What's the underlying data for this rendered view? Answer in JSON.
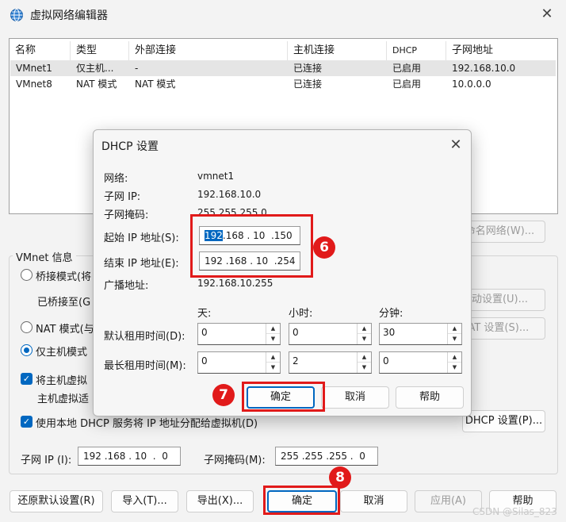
{
  "window": {
    "title": "虚拟网络编辑器",
    "close_glyph": "✕"
  },
  "netlist": {
    "headers": [
      "名称",
      "类型",
      "外部连接",
      "主机连接",
      "DHCP",
      "子网地址"
    ],
    "rows": [
      [
        "VMnet1",
        "仅主机...",
        "-",
        "已连接",
        "已启用",
        "192.168.10.0"
      ],
      [
        "VMnet8",
        "NAT 模式",
        "NAT 模式",
        "已连接",
        "已启用",
        "10.0.0.0"
      ]
    ]
  },
  "right_buttons": {
    "rename": "重命名网络(W)...",
    "auto": "自动设置(U)...",
    "nat": "NAT 设置(S)..."
  },
  "vmnet_info": {
    "group_label": "VMnet 信息",
    "bridged": "桥接模式(将",
    "bridged_to": "已桥接至(G",
    "nat": "NAT 模式(与",
    "host_only": "仅主机模式",
    "connect_adapter": "将主机虚拟",
    "adapter_name": "主机虚拟适",
    "use_dhcp": "使用本地 DHCP 服务将 IP 地址分配给虚拟机(D)",
    "dhcp_settings_button": "DHCP 设置(P)...",
    "subnet_ip_label": "子网 IP (I):",
    "subnet_ip": "192 .168 . 10  .  0",
    "subnet_mask_label": "子网掩码(M):",
    "subnet_mask": "255 .255 .255 .  0"
  },
  "bottom_buttons": {
    "restore": "还原默认设置(R)",
    "import": "导入(T)...",
    "export": "导出(X)...",
    "ok": "确定",
    "cancel": "取消",
    "apply": "应用(A)",
    "help": "帮助"
  },
  "dialog": {
    "title": "DHCP 设置",
    "close_glyph": "✕",
    "network_label": "网络:",
    "network": "vmnet1",
    "subnet_ip_label": "子网 IP:",
    "subnet_ip": "192.168.10.0",
    "subnet_mask_label": "子网掩码:",
    "subnet_mask": "255.255.255.0",
    "start_label": "起始 IP 地址(S):",
    "start_ip_selected": "192",
    "start_ip_rest": ".168 . 10  .150",
    "end_label": "结束 IP 地址(E):",
    "end_ip": "192 .168 . 10  .254",
    "broadcast_label": "广播地址:",
    "broadcast": "192.168.10.255",
    "col_days": "天:",
    "col_hours": "小时:",
    "col_minutes": "分钟:",
    "default_lease_label": "默认租用时间(D):",
    "default_lease": [
      "0",
      "0",
      "30"
    ],
    "max_lease_label": "最长租用时间(M):",
    "max_lease": [
      "0",
      "2",
      "0"
    ],
    "ok": "确定",
    "cancel": "取消",
    "help": "帮助"
  },
  "annotations": {
    "m6": "6",
    "m7": "7",
    "m8": "8",
    "color": "#e11a1a"
  },
  "watermark": "CSDN @Silas_823"
}
